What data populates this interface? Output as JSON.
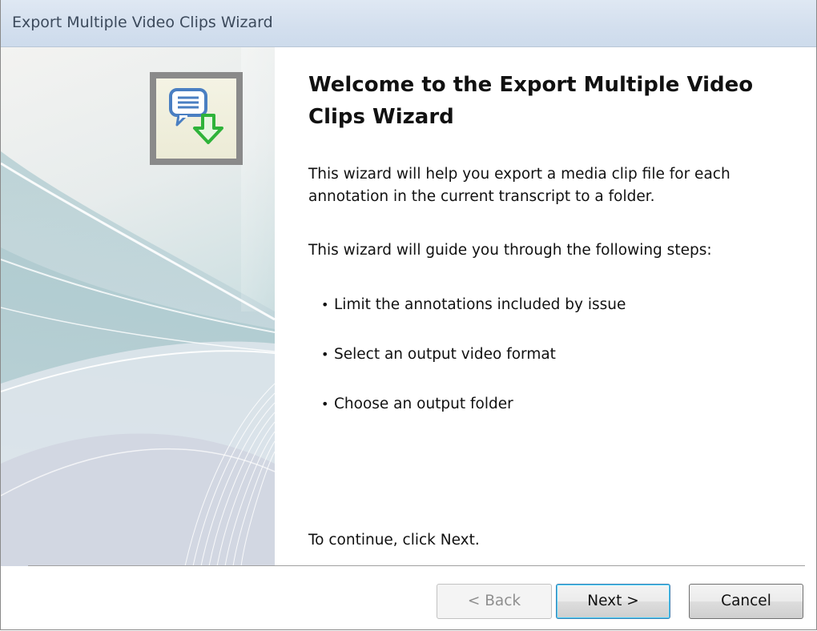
{
  "window": {
    "title": "Export Multiple Video Clips Wizard"
  },
  "wizard": {
    "heading": "Welcome to the Export Multiple Video Clips Wizard",
    "intro": "This wizard will help you export a media clip file for each annotation in the current transcript to a folder.",
    "steps_intro": "This wizard will guide you through the following steps:",
    "bullet": "•",
    "steps": [
      "Limit the annotations included by issue",
      "Select an output video format",
      "Choose an output folder"
    ],
    "continue_text": "To continue, click Next.",
    "icon": "speech-bubble-download-icon"
  },
  "buttons": {
    "back": "< Back",
    "next": "Next >",
    "cancel": "Cancel"
  },
  "colors": {
    "title_bar": "#d3dfee",
    "icon_arrow": "#2fb33a",
    "icon_bubble": "#4a7fc2",
    "default_button_border": "#3c7fb1"
  }
}
